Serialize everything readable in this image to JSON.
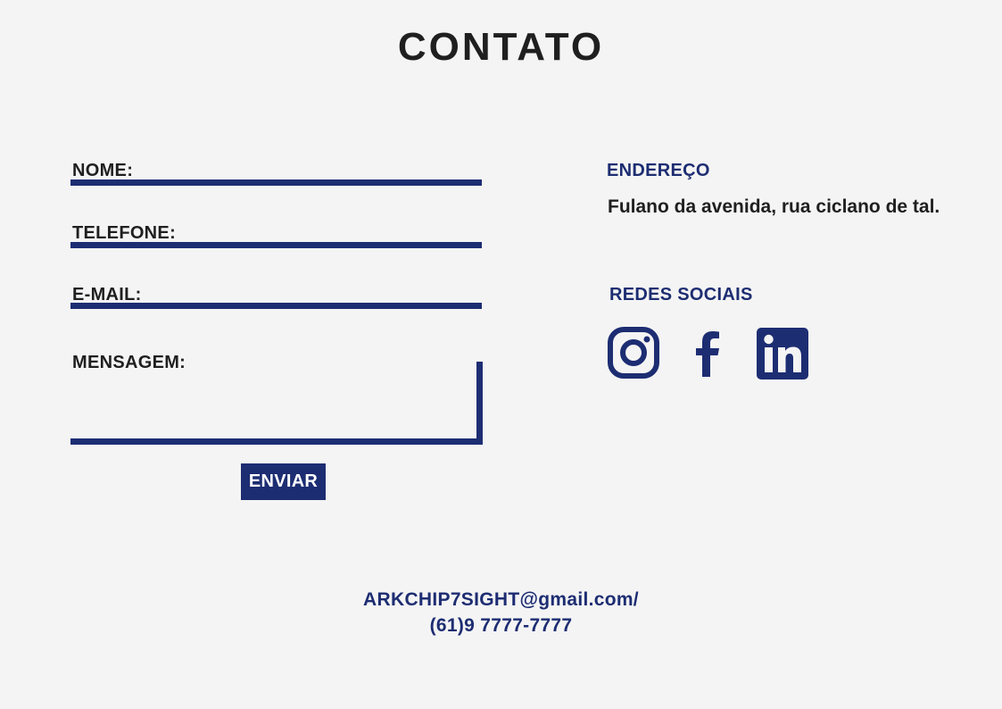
{
  "page": {
    "title": "CONTATO"
  },
  "form": {
    "name_label": "NOME:",
    "phone_label": "TELEFONE:",
    "email_label": "E-MAIL:",
    "message_label": "MENSAGEM:",
    "submit_label": "ENVIAR"
  },
  "address": {
    "heading": "ENDEREÇO",
    "text": "Fulano da avenida, rua ciclano de tal."
  },
  "social": {
    "heading": "REDES SOCIAIS",
    "icons": [
      "instagram-icon",
      "facebook-icon",
      "linkedin-icon"
    ]
  },
  "footer": {
    "email": "ARKCHIP7SIGHT@gmail.com/",
    "phone": "(61)9 7777-7777"
  },
  "colors": {
    "accent": "#1d2d72",
    "text": "#1f1f1f",
    "background": "#f4f4f4"
  }
}
